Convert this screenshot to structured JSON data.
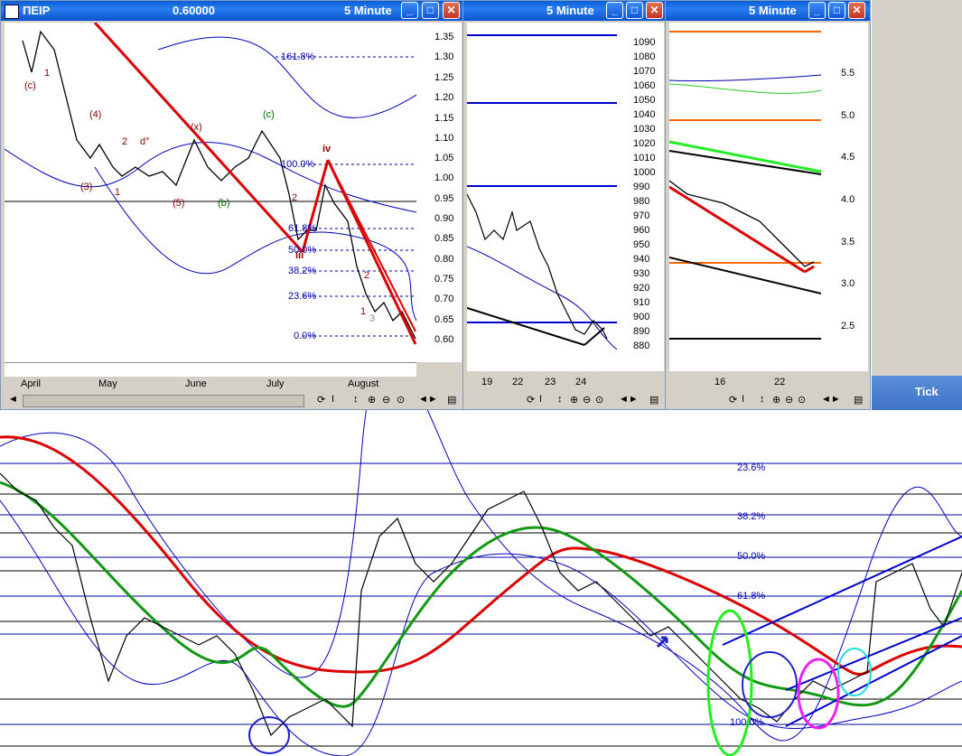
{
  "window1": {
    "title": "ΠΕΙΡ",
    "price": "0.60000",
    "interval": "5 Minute",
    "y_ticks": [
      "1.35",
      "1.30",
      "1.25",
      "1.20",
      "1.15",
      "1.10",
      "1.05",
      "1.00",
      "0.95",
      "0.90",
      "0.85",
      "0.80",
      "0.75",
      "0.70",
      "0.65",
      "0.60"
    ],
    "x_ticks": [
      "April",
      "May",
      "June",
      "July",
      "August"
    ],
    "fib_labels": [
      "161.8%",
      "100.0%",
      "61.8%",
      "50.0%",
      "38.2%",
      "23.6%",
      "0.0%"
    ],
    "wave_labels": [
      "(c)",
      "1",
      "(4)",
      "2",
      "d°",
      "(x)",
      "(c)",
      "iv",
      "(3)",
      "1",
      "(5)",
      "(b)",
      "2",
      "iii",
      "2",
      "1",
      "3"
    ]
  },
  "window2": {
    "interval": "5 Minute",
    "y_ticks": [
      "1090",
      "1080",
      "1070",
      "1060",
      "1050",
      "1040",
      "1030",
      "1020",
      "1010",
      "1000",
      "990",
      "980",
      "970",
      "960",
      "950",
      "940",
      "930",
      "920",
      "910",
      "900",
      "890",
      "880"
    ],
    "x_ticks": [
      "19",
      "22",
      "23",
      "24"
    ]
  },
  "window3": {
    "interval": "5 Minute",
    "y_ticks": [
      "5.5",
      "5.0",
      "4.5",
      "4.0",
      "3.5",
      "3.0",
      "2.5"
    ],
    "x_ticks": [
      "16",
      "22"
    ]
  },
  "tick_window": {
    "title": "Tick"
  },
  "main_chart": {
    "fib_labels": [
      "23.6%",
      "38.2%",
      "50.0%",
      "61.8%",
      "100.0%"
    ]
  },
  "colors": {
    "title_blue": "#0b54cc",
    "price": "#000000",
    "moving_avg_red": "#dd0000",
    "moving_avg_green": "#119911",
    "band_blue": "#0000bb",
    "fib_blue": "#0000aa",
    "ellipse_green": "#22ee22",
    "ellipse_blue": "#2222cc",
    "ellipse_magenta": "#ee22ee",
    "ellipse_cyan": "#22dddd",
    "orange_line": "#ff6600"
  },
  "controls": {
    "icons": [
      "refresh-icon",
      "cursor-icon",
      "move-icon",
      "zoom-in-icon",
      "zoom-out-icon",
      "zoom-fit-icon",
      "scroll-left-icon",
      "scroll-right-icon",
      "menu-icon"
    ]
  }
}
